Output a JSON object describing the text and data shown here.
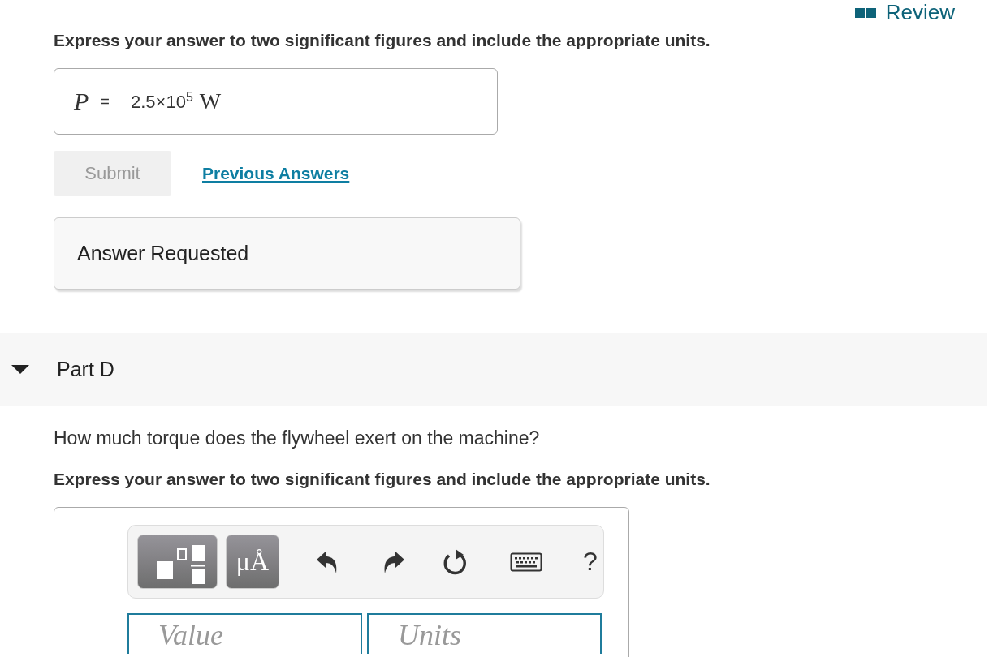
{
  "review_link": "Review",
  "part_c": {
    "instruction": "Express your answer to two significant figures and include the appropriate units.",
    "answer": {
      "variable": "P",
      "equals": "=",
      "value": "2.5×10$^{5}$",
      "unit": "W"
    },
    "submit": {
      "label": "Submit",
      "disabled": true
    },
    "previous_answers": "Previous Answers",
    "feedback": "Answer Requested"
  },
  "part_d": {
    "title": "Part D",
    "expanded": true,
    "question": "How much torque does the flywheel exert on the machine?",
    "instruction": "Express your answer to two significant figures and include the appropriate units.",
    "toolbar": [
      {
        "kind": "templates"
      },
      {
        "kind": "units",
        "label": "μÅ"
      },
      {
        "kind": "undo"
      },
      {
        "kind": "redo"
      },
      {
        "kind": "reset"
      },
      {
        "kind": "keyboard"
      },
      {
        "kind": "help",
        "label": "?"
      }
    ],
    "value_field": {
      "placeholder": "Value"
    },
    "units_field": {
      "placeholder": "Units"
    }
  }
}
